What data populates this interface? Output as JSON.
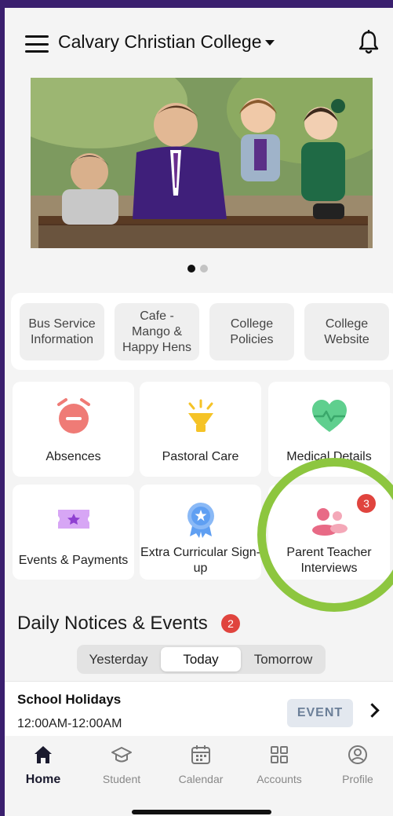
{
  "header": {
    "title": "Calvary Christian College"
  },
  "carousel": {
    "slide_count": 2,
    "active_index": 0
  },
  "quick_links": [
    {
      "label": "Bus Service Information"
    },
    {
      "label": "Cafe - Mango & Happy Hens"
    },
    {
      "label": "College Policies"
    },
    {
      "label": "College Website"
    }
  ],
  "tiles": [
    {
      "label": "Absences",
      "icon": "alarm-clock-icon"
    },
    {
      "label": "Pastoral Care",
      "icon": "lamp-icon"
    },
    {
      "label": "Medical Details",
      "icon": "heart-icon"
    },
    {
      "label": "Events & Payments",
      "icon": "ticket-icon"
    },
    {
      "label": "Extra Curricular Sign-up",
      "icon": "award-ribbon-icon"
    },
    {
      "label": "Parent Teacher Interviews",
      "icon": "people-icon",
      "badge": "3"
    }
  ],
  "notices": {
    "title": "Daily Notices & Events",
    "badge": "2",
    "segments": [
      "Yesterday",
      "Today",
      "Tomorrow"
    ],
    "active_segment": "Today",
    "events": [
      {
        "title": "School Holidays",
        "time": "12:00AM-12:00AM",
        "tag": "EVENT"
      }
    ]
  },
  "tabbar": [
    {
      "label": "Home",
      "icon": "home-icon",
      "active": true
    },
    {
      "label": "Student",
      "icon": "graduation-cap-icon"
    },
    {
      "label": "Calendar",
      "icon": "calendar-icon"
    },
    {
      "label": "Accounts",
      "icon": "grid-icon"
    },
    {
      "label": "Profile",
      "icon": "profile-icon"
    }
  ],
  "colors": {
    "highlight_ring": "#8dc63f",
    "badge_red": "#e0443e",
    "background_frame": "#3a1f6e",
    "tile_icon_red": "#ef7b76",
    "tile_icon_yellow": "#f5c327",
    "tile_icon_green": "#5fcf8e",
    "tile_icon_purple": "#c58df0",
    "tile_icon_blue": "#5f9ff2",
    "tile_icon_pink": "#e86a86"
  }
}
